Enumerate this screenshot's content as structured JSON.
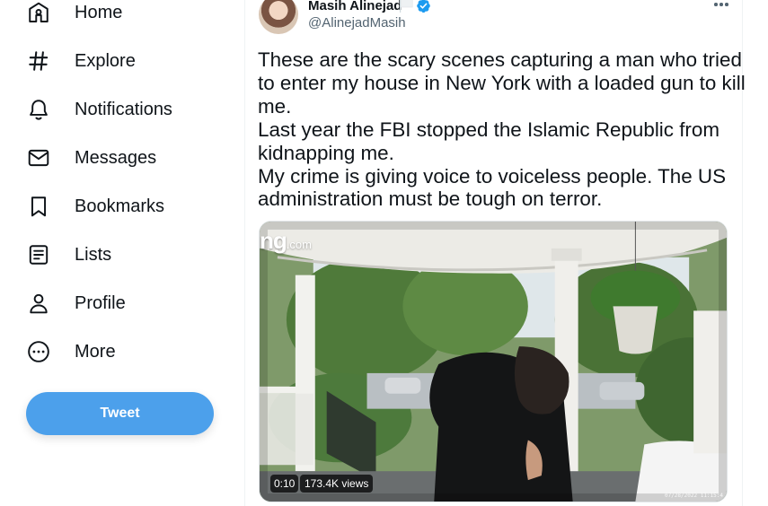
{
  "sidebar": {
    "items": [
      {
        "label": "Home",
        "icon": "home-icon"
      },
      {
        "label": "Explore",
        "icon": "hashtag-icon"
      },
      {
        "label": "Notifications",
        "icon": "bell-icon"
      },
      {
        "label": "Messages",
        "icon": "envelope-icon"
      },
      {
        "label": "Bookmarks",
        "icon": "bookmark-icon"
      },
      {
        "label": "Lists",
        "icon": "list-icon"
      },
      {
        "label": "Profile",
        "icon": "person-icon"
      },
      {
        "label": "More",
        "icon": "more-circle-icon"
      }
    ],
    "tweet_button": "Tweet"
  },
  "tweet": {
    "author_name": "Masih Alinejad",
    "author_handle": "@AlinejadMasih",
    "text_lines": [
      "These are the scary scenes capturing a man who tried",
      "to enter my house in New York with a loaded gun to kill",
      "me.",
      "Last year the FBI stopped the Islamic Republic from",
      "kidnapping me.",
      "My crime is giving voice to voiceless people. The US",
      "administration must be tough on terror."
    ],
    "media": {
      "watermark": "ng",
      "watermark_suffix": ".com",
      "duration": "0:10",
      "views": "173.4K views",
      "timestamp": "07/28/2022 11:15:4"
    }
  },
  "colors": {
    "accent": "#4ca0eb",
    "verified": "#1d9bf0",
    "text": "#0f1419",
    "secondary_text": "#536471"
  }
}
